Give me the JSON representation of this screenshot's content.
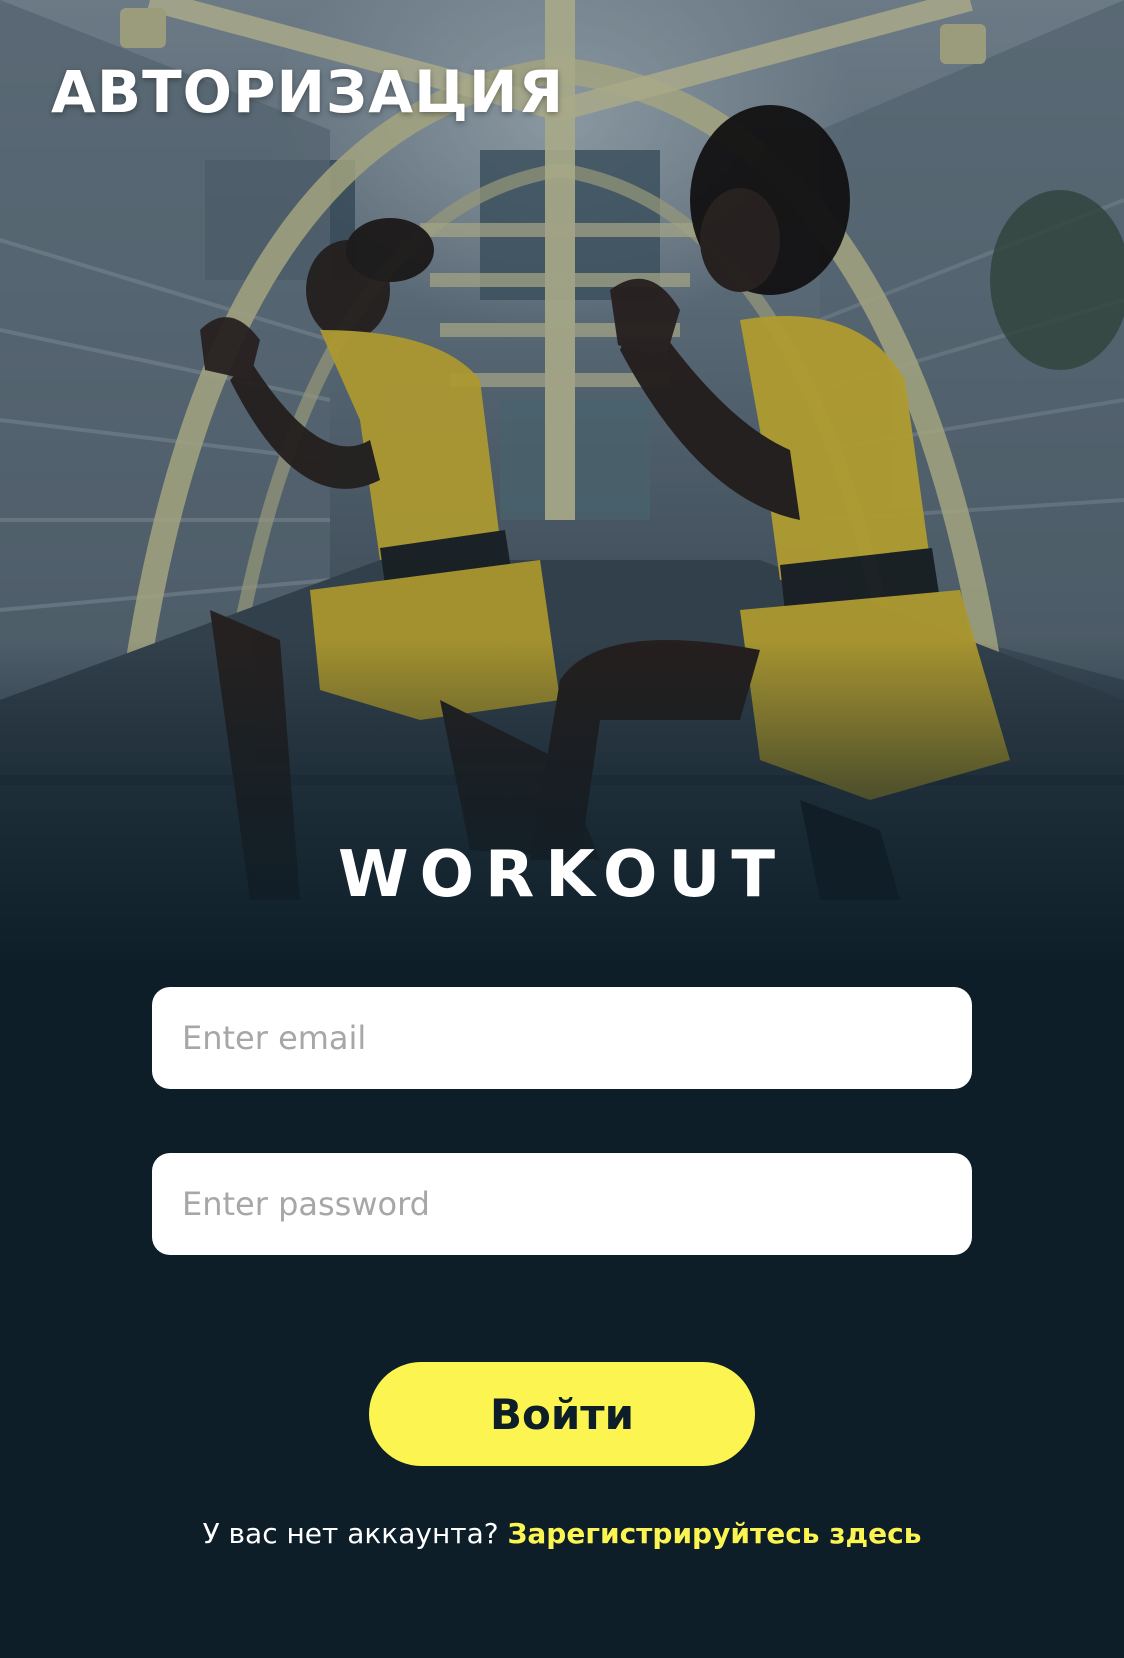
{
  "header": {
    "title": "АВТОРИЗАЦИЯ"
  },
  "hero": {
    "image": "two-athletes-lunge-on-bridge-photo",
    "brand_name": "WORKOUT"
  },
  "form": {
    "email_placeholder": "Enter email",
    "email_value": "",
    "password_placeholder": "Enter password",
    "password_value": "",
    "submit_label": "Войти"
  },
  "signup": {
    "prompt": "У вас нет аккаунта?",
    "link_label": "Зарегистрируйтесь здесь"
  },
  "colors": {
    "background": "#0d1e29",
    "accent": "#fcf551",
    "input_background": "#ffffff",
    "text": "#ffffff"
  }
}
